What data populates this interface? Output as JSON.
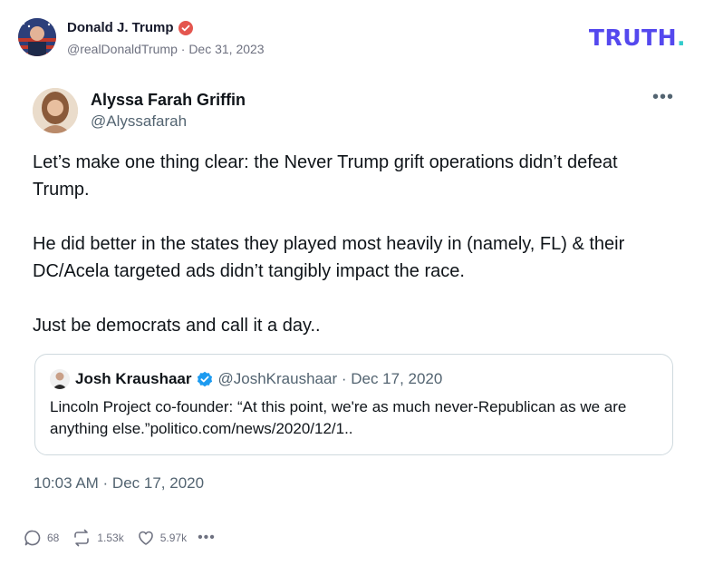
{
  "post": {
    "author_name": "Donald J. Trump",
    "author_handle": "@realDonaldTrump",
    "date_sep": " · ",
    "date": "Dec 31, 2023",
    "logo_text": "TRUTH",
    "logo_dot": "."
  },
  "tweet": {
    "author_name": "Alyssa Farah Griffin",
    "author_handle": "@Alyssafarah",
    "paragraphs": [
      "Let’s make one thing clear: the Never Trump grift operations didn’t defeat Trump.",
      "He did better in the states they played most heavily in (namely, FL) & their DC/Acela targeted ads didn’t tangibly impact the race.",
      "Just be democrats and call it a day.."
    ],
    "timestamp": "10:03 AM · Dec 17, 2020",
    "more_icon": "•••"
  },
  "quote": {
    "author_name": "Josh Kraushaar",
    "author_handle": "@JoshKraushaar · Dec 17, 2020",
    "text": "Lincoln Project co-founder: “At this point, we're as much never-Republican as we are anything else.”politico.com/news/2020/12/1.."
  },
  "actions": {
    "replies": "68",
    "retruths": "1.53k",
    "likes": "5.97k",
    "more": "•••"
  },
  "colors": {
    "truth_purple": "#5448ee",
    "truth_teal": "#33cccc",
    "verified_pink": "#e4564f",
    "verified_blue": "#1d9bf0"
  },
  "icons": [
    "verified-badge-icon",
    "more-icon",
    "reply-icon",
    "retruth-icon",
    "like-icon"
  ]
}
